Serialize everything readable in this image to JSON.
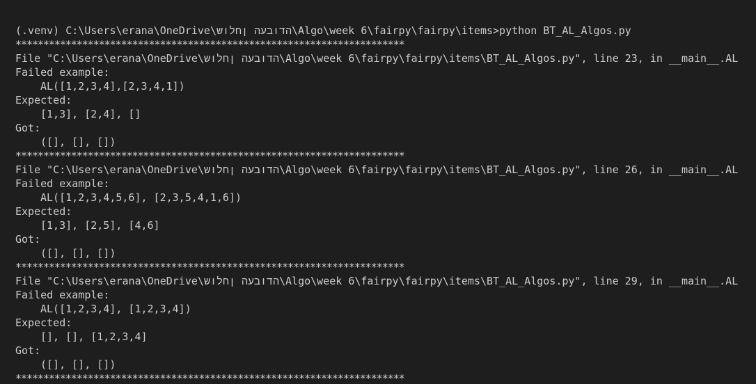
{
  "terminal": {
    "prompt_line": "(.venv) C:\\Users\\erana\\OneDrive\\הדובעה ןחלוש\\Algo\\week 6\\fairpy\\fairpy\\items>python BT_AL_Algos.py",
    "separator": "**********************************************************************",
    "failures": [
      {
        "file_line": "File \"C:\\Users\\erana\\OneDrive\\הדובעה ןחלוש\\Algo\\week 6\\fairpy\\fairpy\\items\\BT_AL_Algos.py\", line 23, in __main__.AL",
        "failed_label": "Failed example:",
        "example": "AL([1,2,3,4],[2,3,4,1])",
        "expected_label": "Expected:",
        "expected": "[1,3], [2,4], []",
        "got_label": "Got:",
        "got": "([], [], [])"
      },
      {
        "file_line": "File \"C:\\Users\\erana\\OneDrive\\הדובעה ןחלוש\\Algo\\week 6\\fairpy\\fairpy\\items\\BT_AL_Algos.py\", line 26, in __main__.AL",
        "failed_label": "Failed example:",
        "example": "AL([1,2,3,4,5,6], [2,3,5,4,1,6])",
        "expected_label": "Expected:",
        "expected": "[1,3], [2,5], [4,6]",
        "got_label": "Got:",
        "got": "([], [], [])"
      },
      {
        "file_line": "File \"C:\\Users\\erana\\OneDrive\\הדובעה ןחלוש\\Algo\\week 6\\fairpy\\fairpy\\items\\BT_AL_Algos.py\", line 29, in __main__.AL",
        "failed_label": "Failed example:",
        "example": "AL([1,2,3,4], [1,2,3,4])",
        "expected_label": "Expected:",
        "expected": "[], [], [1,2,3,4]",
        "got_label": "Got:",
        "got": "([], [], [])"
      }
    ]
  },
  "colors": {
    "background": "#1e1e1e",
    "text": "#cccccc"
  }
}
